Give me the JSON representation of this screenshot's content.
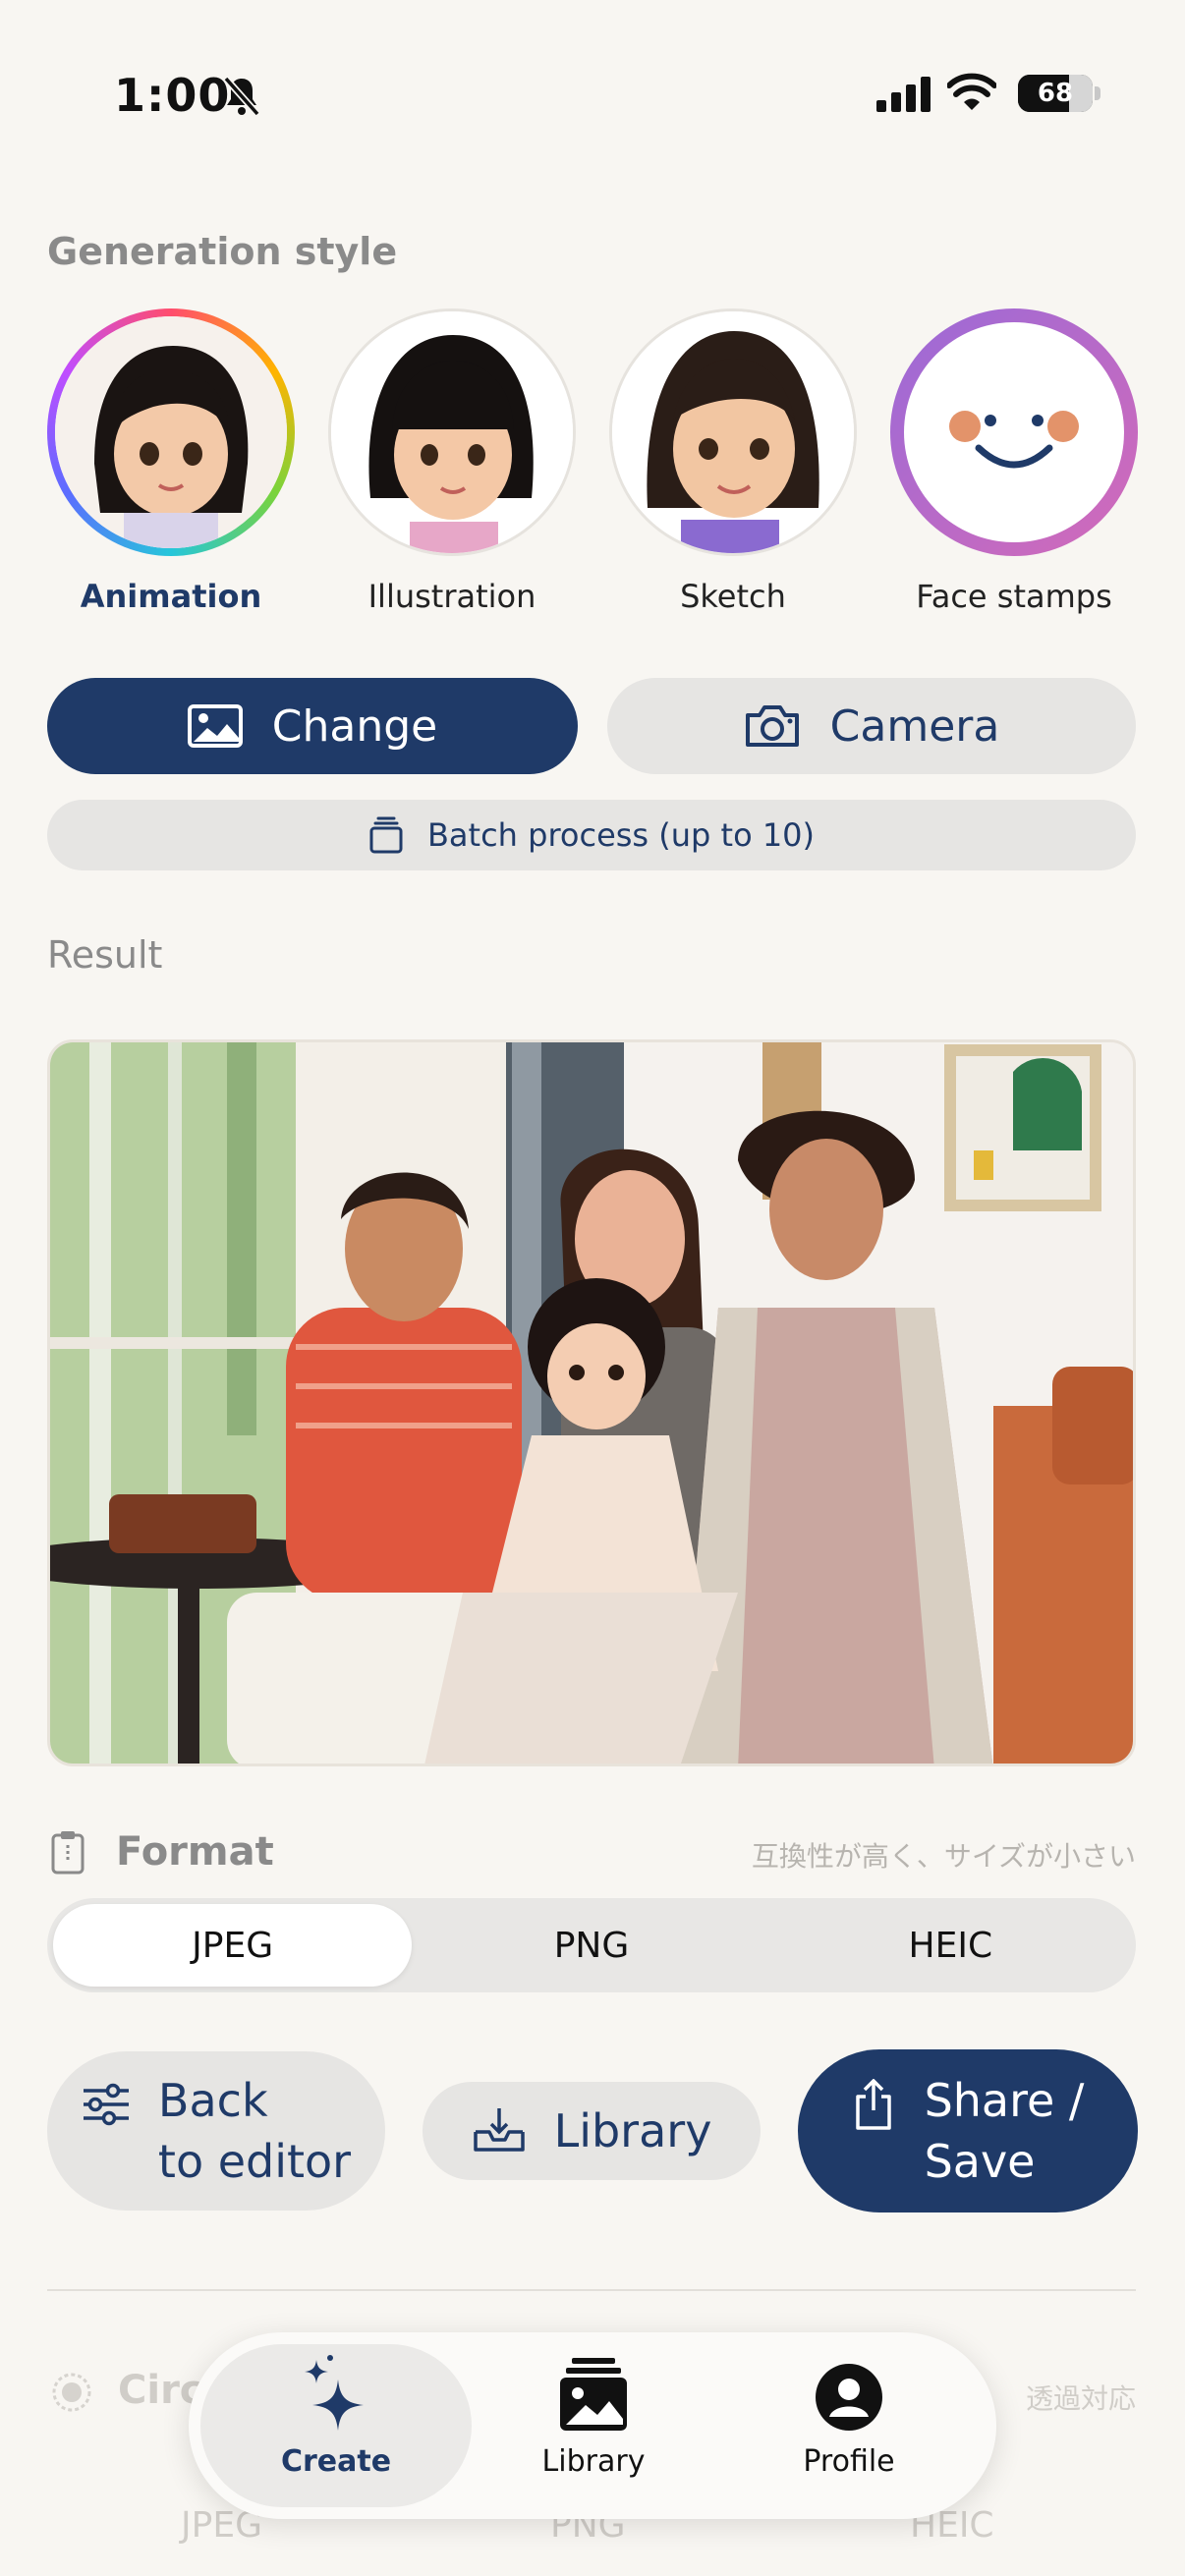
{
  "status": {
    "time": "1:00",
    "battery": "68"
  },
  "generation": {
    "label": "Generation style",
    "styles": [
      {
        "name": "Animation"
      },
      {
        "name": "Illustration"
      },
      {
        "name": "Sketch"
      },
      {
        "name": "Face stamps"
      }
    ]
  },
  "actions": {
    "change": "Change",
    "camera": "Camera",
    "batch": "Batch process (up to 10)"
  },
  "result": {
    "label": "Result"
  },
  "format": {
    "label": "Format",
    "hint": "互換性が高く、サイズが小さい",
    "options": [
      "JPEG",
      "PNG",
      "HEIC"
    ],
    "selected": "JPEG"
  },
  "bottom_actions": {
    "back_line1": "Back",
    "back_line2": "to editor",
    "library": "Library",
    "share_line1": "Share /",
    "share_line2": "Save"
  },
  "faded": {
    "circle": "Circ",
    "transparent": "透過対応",
    "options": [
      "JPEG",
      "PNG",
      "HEIC"
    ]
  },
  "tabbar": {
    "tabs": [
      {
        "label": "Create"
      },
      {
        "label": "Library"
      },
      {
        "label": "Profile"
      }
    ]
  },
  "colors": {
    "accent": "#1f3a68",
    "background": "#f8f6f2"
  }
}
